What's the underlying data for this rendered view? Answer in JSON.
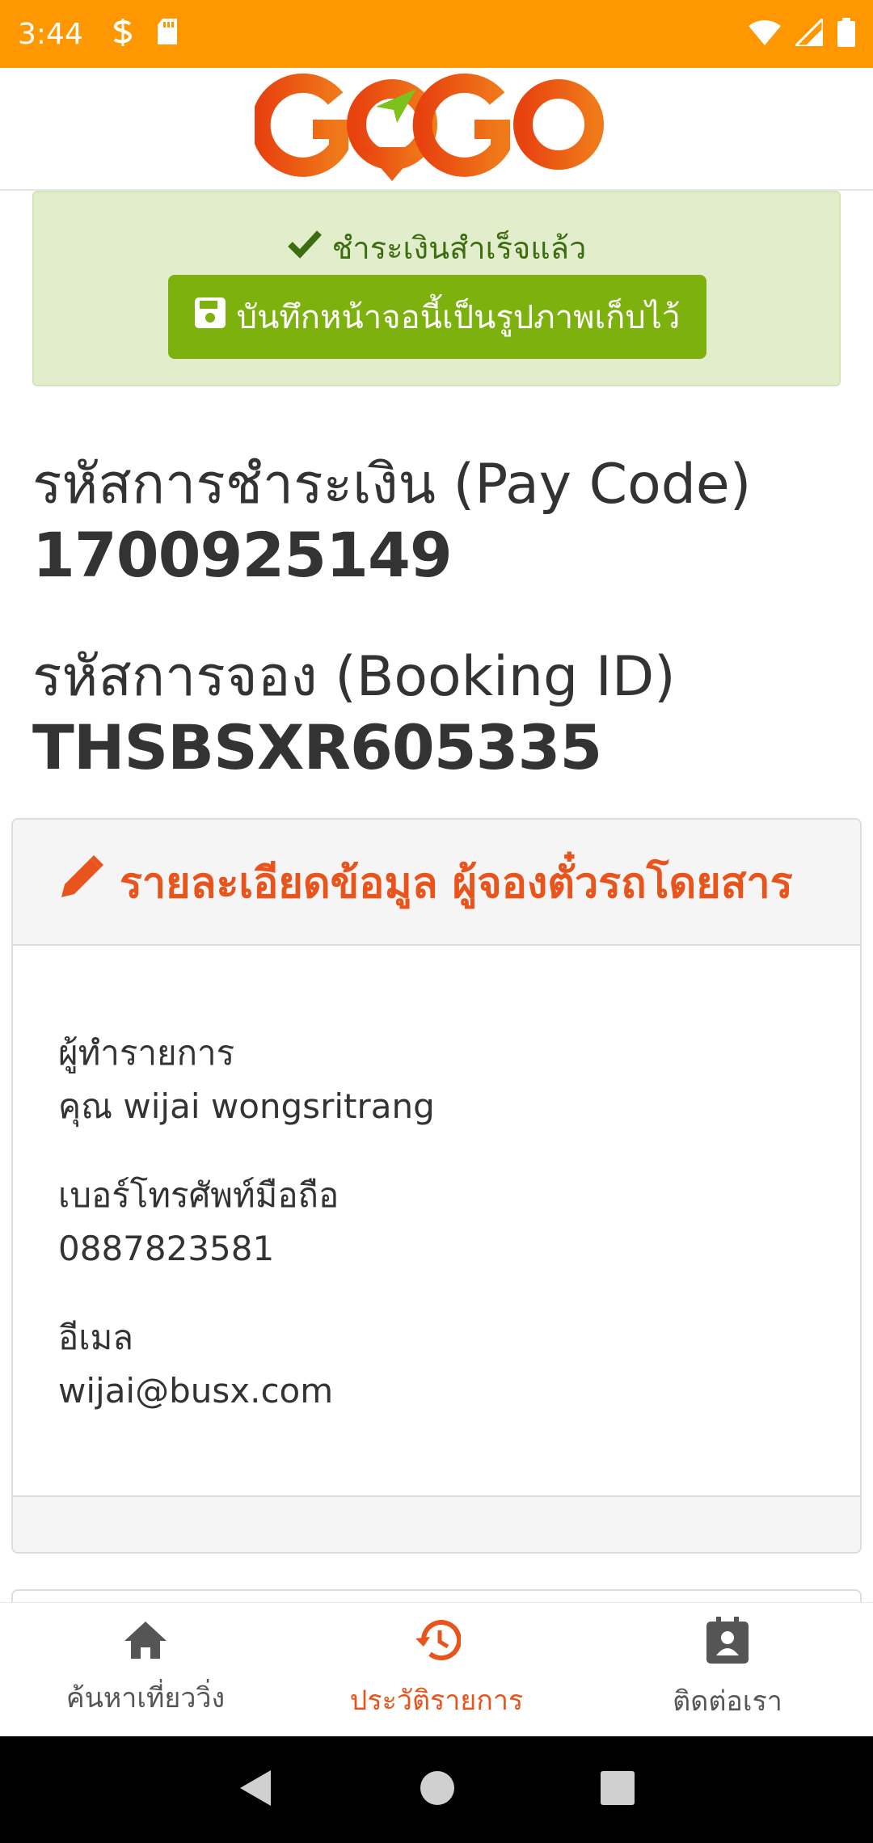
{
  "status_bar": {
    "time": "3:44",
    "left_icons": [
      "s-notification-icon",
      "sd-card-icon"
    ],
    "right_icons": [
      "wifi-icon",
      "signal-icon",
      "battery-icon"
    ],
    "bg_color": "#ff9800"
  },
  "header": {
    "logo_text": "GOGO",
    "logo_color": "#ee5a12",
    "logo_accent": "#7cc11e"
  },
  "success": {
    "message": "ชำระเงินสำเร็จแล้ว",
    "save_button": "บันทึกหน้าจอนี้เป็นรูปภาพเก็บไว้",
    "bg_color": "#e2eecb",
    "button_color": "#7cb10e"
  },
  "pay_code": {
    "label": "รหัสการชำระเงิน (Pay Code)",
    "value": "1700925149"
  },
  "booking": {
    "label": "รหัสการจอง (Booking ID)",
    "value": "THSBSXR605335"
  },
  "card": {
    "title": "รายละเอียดข้อมูล ผู้จองตั๋วรถโดยสาร",
    "title_color": "#e8541b",
    "fields": [
      {
        "label": "ผู้ทำรายการ",
        "value": "คุณ wijai wongsritrang"
      },
      {
        "label": "เบอร์โทรศัพท์มือถือ",
        "value": "0887823581"
      },
      {
        "label": "อีเมล",
        "value": "wijai@busx.com"
      }
    ]
  },
  "bottom_nav": {
    "items": [
      {
        "label": "ค้นหาเที่ยววิ่ง",
        "icon": "home-icon",
        "active": false
      },
      {
        "label": "ประวัติรายการ",
        "icon": "history-icon",
        "active": true
      },
      {
        "label": "ติดต่อเรา",
        "icon": "contact-icon",
        "active": false
      }
    ],
    "active_color": "#e8541b"
  }
}
